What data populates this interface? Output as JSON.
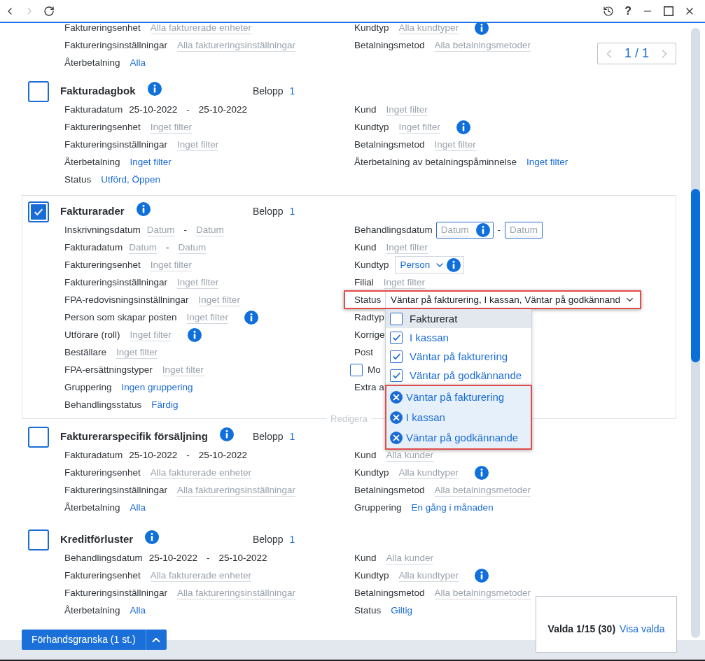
{
  "toolbar": {
    "left": [
      {
        "kind": "back",
        "disabled": false
      },
      {
        "kind": "forward",
        "disabled": true
      },
      {
        "kind": "refresh",
        "disabled": false
      }
    ],
    "right": [
      {
        "kind": "history"
      },
      {
        "kind": "help",
        "label": "?"
      },
      {
        "kind": "minimize"
      },
      {
        "kind": "maximize"
      },
      {
        "kind": "close"
      }
    ]
  },
  "pager": {
    "label": "1 / 1",
    "prev_disabled": true,
    "next_disabled": true
  },
  "previous_section": {
    "rows_left": [
      {
        "kind": "filter",
        "label": "Faktureringsenhet",
        "value": "Alla fakturerade enheter",
        "emphasized": false
      },
      {
        "kind": "filter",
        "label": "Faktureringsinställningar",
        "value": "Alla faktureringsinställningar",
        "emphasized": false
      },
      {
        "kind": "filter",
        "label": "Återbetalning",
        "value": "Alla",
        "emphasized": true
      }
    ],
    "rows_right": [
      {
        "kind": "filter",
        "label": "Kundtyp",
        "value": "Alla kundtyper",
        "emphasized": false,
        "info": true
      },
      {
        "kind": "filter",
        "label": "Betalningsmetod",
        "value": "Alla betalningsmetoder",
        "emphasized": false
      }
    ]
  },
  "sections": [
    {
      "title": "Fakturadagbok",
      "checked": false,
      "editing": false,
      "amount_label": "Belopp",
      "amount": "1",
      "rows_left": [
        {
          "kind": "date_range",
          "label": "Fakturadatum",
          "from": {
            "value": "25-10-2022"
          },
          "separator": "-",
          "to": {
            "value": "25-10-2022"
          }
        },
        {
          "kind": "filter",
          "label": "Faktureringsenhet",
          "value": "Inget filter",
          "emphasized": false
        },
        {
          "kind": "filter",
          "label": "Faktureringsinställningar",
          "value": "Inget filter",
          "emphasized": false
        },
        {
          "kind": "filter",
          "label": "Återbetalning",
          "value": "Inget filter",
          "emphasized": true
        },
        {
          "kind": "filter",
          "label": "Status",
          "value": "Utförd, Öppen",
          "emphasized": true
        }
      ],
      "rows_right": [
        {
          "kind": "filter",
          "label": "Kund",
          "value": "Inget filter",
          "emphasized": false
        },
        {
          "kind": "filter",
          "label": "Kundtyp",
          "value": "Inget filter",
          "emphasized": false,
          "info": true
        },
        {
          "kind": "filter",
          "label": "Betalningsmetod",
          "value": "Inget filter",
          "emphasized": false
        },
        {
          "kind": "filter",
          "label": "Återbetalning av betalningspåminnelse",
          "value": "Inget filter",
          "emphasized": true
        }
      ]
    },
    {
      "title": "Fakturarader",
      "checked": true,
      "editing": true,
      "edit_label": "Redigera",
      "amount_label": "Belopp",
      "amount": "1",
      "rows_left": [
        {
          "kind": "date_range",
          "label": "Inskrivningsdatum",
          "from": {
            "placeholder": "Datum"
          },
          "separator": "-",
          "to": {
            "placeholder": "Datum"
          }
        },
        {
          "kind": "date_range",
          "label": "Fakturadatum",
          "from": {
            "placeholder": "Datum"
          },
          "separator": "-",
          "to": {
            "placeholder": "Datum"
          }
        },
        {
          "kind": "filter",
          "label": "Faktureringsenhet",
          "value": "Inget filter",
          "emphasized": false
        },
        {
          "kind": "filter",
          "label": "Faktureringsinställningar",
          "value": "Inget filter",
          "emphasized": false
        },
        {
          "kind": "filter",
          "label": "FPA-redovisningsinställningar",
          "value": "Inget filter",
          "emphasized": false
        },
        {
          "kind": "filter",
          "label": "Person som skapar posten",
          "value": "Inget filter",
          "emphasized": false,
          "info": true
        },
        {
          "kind": "filter",
          "label": "Utförare (roll)",
          "value": "Inget filter",
          "emphasized": false,
          "info": true
        },
        {
          "kind": "filter",
          "label": "Beställare",
          "value": "Inget filter",
          "emphasized": false
        },
        {
          "kind": "filter",
          "label": "FPA-ersättningstyper",
          "value": "Inget filter",
          "emphasized": false
        },
        {
          "kind": "filter",
          "label": "Gruppering",
          "value": "Ingen gruppering",
          "emphasized": true
        },
        {
          "kind": "filter",
          "label": "Behandlingsstatus",
          "value": "Färdig",
          "emphasized": true
        }
      ],
      "rows_right": [
        {
          "kind": "date_inputs",
          "label": "Behandlingsdatum",
          "from": {
            "placeholder": "Datum",
            "info": true
          },
          "separator": "-",
          "to": {
            "placeholder": "Datum",
            "info": false
          }
        },
        {
          "kind": "filter",
          "label": "Kund",
          "value": "Inget filter",
          "emphasized": false
        },
        {
          "kind": "select",
          "label": "Kundtyp",
          "value": "Person",
          "info": true
        },
        {
          "kind": "filter",
          "label": "Filial",
          "value": "Inget filter",
          "emphasized": false
        },
        {
          "kind": "multiselect",
          "label": "Status",
          "value": "Väntar på fakturering, I kassan, Väntar på godkännand",
          "expanded": true,
          "highlighted": true,
          "options": [
            {
              "label": "Fakturerat",
              "checked": false,
              "hovered": true
            },
            {
              "label": "I kassan",
              "checked": true,
              "hovered": false
            },
            {
              "label": "Väntar på fakturering",
              "checked": true,
              "hovered": false
            },
            {
              "label": "Väntar på godkännande",
              "checked": true,
              "hovered": false
            }
          ],
          "chips": [
            "Väntar på fakturering",
            "I kassan",
            "Väntar på godkännande"
          ],
          "chips_highlighted": true
        },
        {
          "kind": "label",
          "label": "Radtyp"
        },
        {
          "kind": "label",
          "label": "Korrige"
        },
        {
          "kind": "label",
          "label": "Post"
        },
        {
          "kind": "checkbox",
          "label": "Mo",
          "checked": false
        },
        {
          "kind": "label",
          "label": "Extra a"
        }
      ]
    },
    {
      "title": "Fakturerarspecifik försäljning",
      "checked": false,
      "editing": false,
      "amount_label": "Belopp",
      "amount": "1",
      "rows_left": [
        {
          "kind": "date_range",
          "label": "Fakturadatum",
          "from": {
            "value": "25-10-2022"
          },
          "separator": "-",
          "to": {
            "value": "25-10-2022"
          }
        },
        {
          "kind": "filter",
          "label": "Faktureringsenhet",
          "value": "Alla fakturerade enheter",
          "emphasized": false
        },
        {
          "kind": "filter",
          "label": "Faktureringsinställningar",
          "value": "Alla faktureringsinställningar",
          "emphasized": false
        },
        {
          "kind": "filter",
          "label": "Återbetalning",
          "value": "Alla",
          "emphasized": true
        }
      ],
      "rows_right": [
        {
          "kind": "filter",
          "label": "Kund",
          "value": "Alla kunder",
          "emphasized": false
        },
        {
          "kind": "filter",
          "label": "Kundtyp",
          "value": "Alla kundtyper",
          "emphasized": false,
          "info": true
        },
        {
          "kind": "filter",
          "label": "Betalningsmetod",
          "value": "Alla betalningsmetoder",
          "emphasized": false
        },
        {
          "kind": "filter",
          "label": "Gruppering",
          "value": "En gång i månaden",
          "emphasized": true
        }
      ]
    },
    {
      "title": "Kreditförluster",
      "checked": false,
      "editing": false,
      "amount_label": "Belopp",
      "amount": "1",
      "rows_left": [
        {
          "kind": "date_range",
          "label": "Behandlingsdatum",
          "from": {
            "value": "25-10-2022"
          },
          "separator": "-",
          "to": {
            "value": "25-10-2022"
          }
        },
        {
          "kind": "filter",
          "label": "Faktureringsenhet",
          "value": "Alla fakturerade enheter",
          "emphasized": false
        },
        {
          "kind": "filter",
          "label": "Faktureringsinställningar",
          "value": "Alla faktureringsinställningar",
          "emphasized": false
        },
        {
          "kind": "filter",
          "label": "Återbetalning",
          "value": "Alla",
          "emphasized": true
        }
      ],
      "rows_right": [
        {
          "kind": "filter",
          "label": "Kund",
          "value": "Alla kunder",
          "emphasized": false
        },
        {
          "kind": "filter",
          "label": "Kundtyp",
          "value": "Alla kundtyper",
          "emphasized": false,
          "info": true
        },
        {
          "kind": "filter",
          "label": "Betalningsmetod",
          "value": "Alla betalningsmetoder",
          "emphasized": false
        },
        {
          "kind": "filter",
          "label": "Status",
          "value": "Giltig",
          "emphasized": true
        }
      ]
    }
  ],
  "preview": {
    "label": "Förhandsgranska (1 st.)"
  },
  "summary": {
    "text": "Valda 1/15 (30)",
    "link": "Visa valda"
  }
}
